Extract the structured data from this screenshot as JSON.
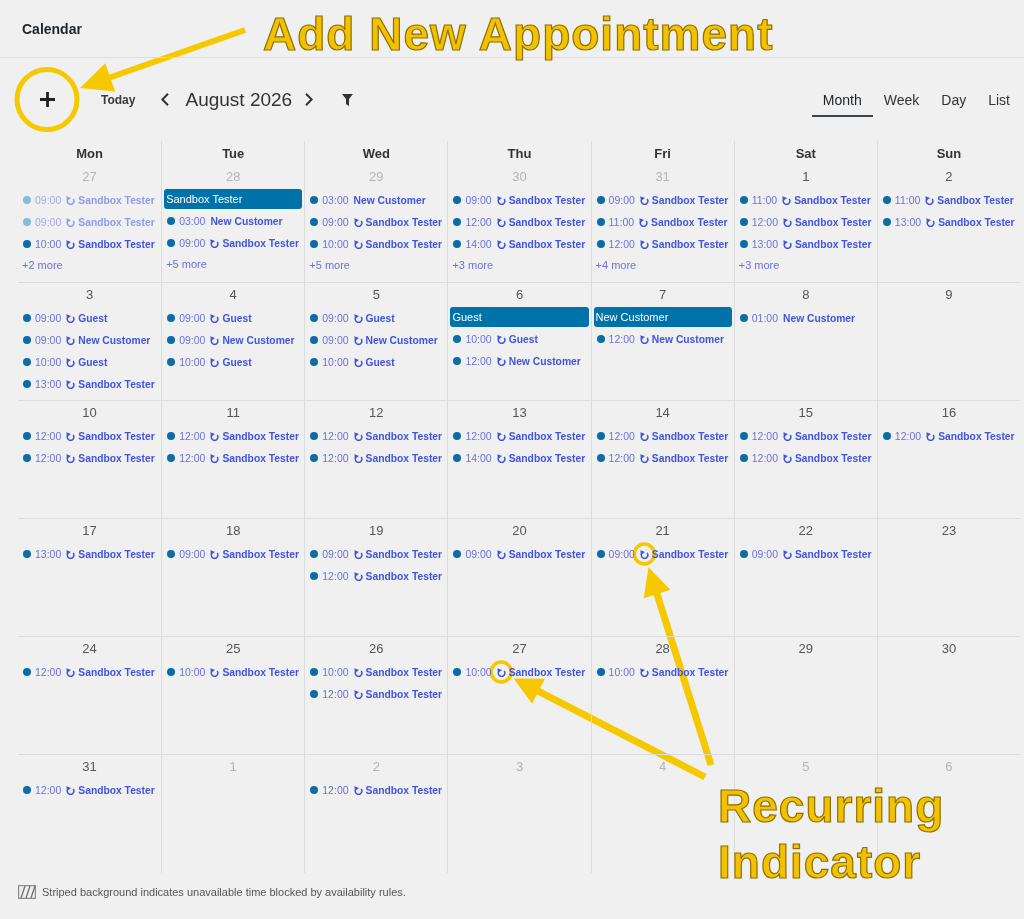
{
  "page": {
    "title": "Calendar"
  },
  "toolbar": {
    "add_button": {
      "circled": true
    },
    "today": "Today",
    "month": "August 2026",
    "views": [
      {
        "label": "Month",
        "selected": true
      },
      {
        "label": "Week",
        "selected": false
      },
      {
        "label": "Day",
        "selected": false
      },
      {
        "label": "List",
        "selected": false
      }
    ]
  },
  "weekdays": [
    "Mon",
    "Tue",
    "Wed",
    "Thu",
    "Fri",
    "Sat",
    "Sun"
  ],
  "weeks": [
    {
      "days": [
        {
          "number": "27",
          "other_month": true,
          "events": [
            {
              "kind": "timed",
              "time": "09:00",
              "recurring": true,
              "title": "Sandbox Tester",
              "dimmed": true,
              "circled": false
            },
            {
              "kind": "timed",
              "time": "09:00",
              "recurring": true,
              "title": "Sandbox Tester",
              "dimmed": true,
              "circled": false
            },
            {
              "kind": "timed",
              "time": "10:00",
              "recurring": true,
              "title": "Sandbox Tester",
              "dimmed": false,
              "circled": false
            }
          ],
          "more": "+2 more"
        },
        {
          "number": "28",
          "other_month": true,
          "events": [
            {
              "kind": "bar",
              "title": "Sandbox Tester"
            },
            {
              "kind": "timed",
              "time": "03:00",
              "recurring": false,
              "title": "New Customer",
              "dimmed": false,
              "circled": false
            },
            {
              "kind": "timed",
              "time": "09:00",
              "recurring": true,
              "title": "Sandbox Tester",
              "dimmed": false,
              "circled": false
            }
          ],
          "more": "+5 more"
        },
        {
          "number": "29",
          "other_month": true,
          "events": [
            {
              "kind": "timed",
              "time": "03:00",
              "recurring": false,
              "title": "New Customer",
              "dimmed": false,
              "circled": false
            },
            {
              "kind": "timed",
              "time": "09:00",
              "recurring": true,
              "title": "Sandbox Tester",
              "dimmed": false,
              "circled": false
            },
            {
              "kind": "timed",
              "time": "10:00",
              "recurring": true,
              "title": "Sandbox Tester",
              "dimmed": false,
              "circled": false
            }
          ],
          "more": "+5 more"
        },
        {
          "number": "30",
          "other_month": true,
          "events": [
            {
              "kind": "timed",
              "time": "09:00",
              "recurring": true,
              "title": "Sandbox Tester",
              "dimmed": false,
              "circled": false
            },
            {
              "kind": "timed",
              "time": "12:00",
              "recurring": true,
              "title": "Sandbox Tester",
              "dimmed": false,
              "circled": false
            },
            {
              "kind": "timed",
              "time": "14:00",
              "recurring": true,
              "title": "Sandbox Tester",
              "dimmed": false,
              "circled": false
            }
          ],
          "more": "+3 more"
        },
        {
          "number": "31",
          "other_month": true,
          "events": [
            {
              "kind": "timed",
              "time": "09:00",
              "recurring": true,
              "title": "Sandbox Tester",
              "dimmed": false,
              "circled": false
            },
            {
              "kind": "timed",
              "time": "11:00",
              "recurring": true,
              "title": "Sandbox Tester",
              "dimmed": false,
              "circled": false
            },
            {
              "kind": "timed",
              "time": "12:00",
              "recurring": true,
              "title": "Sandbox Tester",
              "dimmed": false,
              "circled": false
            }
          ],
          "more": "+4 more"
        },
        {
          "number": "1",
          "other_month": false,
          "events": [
            {
              "kind": "timed",
              "time": "11:00",
              "recurring": true,
              "title": "Sandbox Tester",
              "dimmed": false,
              "circled": false
            },
            {
              "kind": "timed",
              "time": "12:00",
              "recurring": true,
              "title": "Sandbox Tester",
              "dimmed": false,
              "circled": false
            },
            {
              "kind": "timed",
              "time": "13:00",
              "recurring": true,
              "title": "Sandbox Tester",
              "dimmed": false,
              "circled": false
            }
          ],
          "more": "+3 more"
        },
        {
          "number": "2",
          "other_month": false,
          "events": [
            {
              "kind": "timed",
              "time": "11:00",
              "recurring": true,
              "title": "Sandbox Tester",
              "dimmed": false,
              "circled": false
            },
            {
              "kind": "timed",
              "time": "13:00",
              "recurring": true,
              "title": "Sandbox Tester",
              "dimmed": false,
              "circled": false
            }
          ]
        }
      ]
    },
    {
      "days": [
        {
          "number": "3",
          "other_month": false,
          "events": [
            {
              "kind": "timed",
              "time": "09:00",
              "recurring": true,
              "title": "Guest",
              "dimmed": false,
              "circled": false
            },
            {
              "kind": "timed",
              "time": "09:00",
              "recurring": true,
              "title": "New Customer",
              "dimmed": false,
              "circled": false
            },
            {
              "kind": "timed",
              "time": "10:00",
              "recurring": true,
              "title": "Guest",
              "dimmed": false,
              "circled": false
            },
            {
              "kind": "timed",
              "time": "13:00",
              "recurring": true,
              "title": "Sandbox Tester",
              "dimmed": false,
              "circled": false
            }
          ]
        },
        {
          "number": "4",
          "other_month": false,
          "events": [
            {
              "kind": "timed",
              "time": "09:00",
              "recurring": true,
              "title": "Guest",
              "dimmed": false,
              "circled": false
            },
            {
              "kind": "timed",
              "time": "09:00",
              "recurring": true,
              "title": "New Customer",
              "dimmed": false,
              "circled": false
            },
            {
              "kind": "timed",
              "time": "10:00",
              "recurring": true,
              "title": "Guest",
              "dimmed": false,
              "circled": false
            }
          ]
        },
        {
          "number": "5",
          "other_month": false,
          "events": [
            {
              "kind": "timed",
              "time": "09:00",
              "recurring": true,
              "title": "Guest",
              "dimmed": false,
              "circled": false
            },
            {
              "kind": "timed",
              "time": "09:00",
              "recurring": true,
              "title": "New Customer",
              "dimmed": false,
              "circled": false
            },
            {
              "kind": "timed",
              "time": "10:00",
              "recurring": true,
              "title": "Guest",
              "dimmed": false,
              "circled": false
            }
          ]
        },
        {
          "number": "6",
          "other_month": false,
          "events": [
            {
              "kind": "bar",
              "title": "Guest"
            },
            {
              "kind": "timed",
              "time": "10:00",
              "recurring": true,
              "title": "Guest",
              "dimmed": false,
              "circled": false
            },
            {
              "kind": "timed",
              "time": "12:00",
              "recurring": true,
              "title": "New Customer",
              "dimmed": false,
              "circled": false
            }
          ]
        },
        {
          "number": "7",
          "other_month": false,
          "events": [
            {
              "kind": "bar",
              "title": "New Customer"
            },
            {
              "kind": "timed",
              "time": "12:00",
              "recurring": true,
              "title": "New Customer",
              "dimmed": false,
              "circled": false
            }
          ]
        },
        {
          "number": "8",
          "other_month": false,
          "events": [
            {
              "kind": "timed",
              "time": "01:00",
              "recurring": false,
              "title": "New Customer",
              "dimmed": false,
              "circled": false
            }
          ]
        },
        {
          "number": "9",
          "other_month": false
        }
      ]
    },
    {
      "days": [
        {
          "number": "10",
          "other_month": false,
          "events": [
            {
              "kind": "timed",
              "time": "12:00",
              "recurring": true,
              "title": "Sandbox Tester",
              "dimmed": false,
              "circled": false
            },
            {
              "kind": "timed",
              "time": "12:00",
              "recurring": true,
              "title": "Sandbox Tester",
              "dimmed": false,
              "circled": false
            }
          ]
        },
        {
          "number": "11",
          "other_month": false,
          "events": [
            {
              "kind": "timed",
              "time": "12:00",
              "recurring": true,
              "title": "Sandbox Tester",
              "dimmed": false,
              "circled": false
            },
            {
              "kind": "timed",
              "time": "12:00",
              "recurring": true,
              "title": "Sandbox Tester",
              "dimmed": false,
              "circled": false
            }
          ]
        },
        {
          "number": "12",
          "other_month": false,
          "events": [
            {
              "kind": "timed",
              "time": "12:00",
              "recurring": true,
              "title": "Sandbox Tester",
              "dimmed": false,
              "circled": false
            },
            {
              "kind": "timed",
              "time": "12:00",
              "recurring": true,
              "title": "Sandbox Tester",
              "dimmed": false,
              "circled": false
            }
          ]
        },
        {
          "number": "13",
          "other_month": false,
          "events": [
            {
              "kind": "timed",
              "time": "12:00",
              "recurring": true,
              "title": "Sandbox Tester",
              "dimmed": false,
              "circled": false
            },
            {
              "kind": "timed",
              "time": "14:00",
              "recurring": true,
              "title": "Sandbox Tester",
              "dimmed": false,
              "circled": false
            }
          ]
        },
        {
          "number": "14",
          "other_month": false,
          "events": [
            {
              "kind": "timed",
              "time": "12:00",
              "recurring": true,
              "title": "Sandbox Tester",
              "dimmed": false,
              "circled": false
            },
            {
              "kind": "timed",
              "time": "12:00",
              "recurring": true,
              "title": "Sandbox Tester",
              "dimmed": false,
              "circled": false
            }
          ]
        },
        {
          "number": "15",
          "other_month": false,
          "events": [
            {
              "kind": "timed",
              "time": "12:00",
              "recurring": true,
              "title": "Sandbox Tester",
              "dimmed": false,
              "circled": false
            },
            {
              "kind": "timed",
              "time": "12:00",
              "recurring": true,
              "title": "Sandbox Tester",
              "dimmed": false,
              "circled": false
            }
          ]
        },
        {
          "number": "16",
          "other_month": false,
          "events": [
            {
              "kind": "timed",
              "time": "12:00",
              "recurring": true,
              "title": "Sandbox Tester",
              "dimmed": false,
              "circled": false
            }
          ]
        }
      ]
    },
    {
      "days": [
        {
          "number": "17",
          "other_month": false,
          "events": [
            {
              "kind": "timed",
              "time": "13:00",
              "recurring": true,
              "title": "Sandbox Tester",
              "dimmed": false,
              "circled": false
            }
          ]
        },
        {
          "number": "18",
          "other_month": false,
          "events": [
            {
              "kind": "timed",
              "time": "09:00",
              "recurring": true,
              "title": "Sandbox Tester",
              "dimmed": false,
              "circled": false
            }
          ]
        },
        {
          "number": "19",
          "other_month": false,
          "events": [
            {
              "kind": "timed",
              "time": "09:00",
              "recurring": true,
              "title": "Sandbox Tester",
              "dimmed": false,
              "circled": false
            },
            {
              "kind": "timed",
              "time": "12:00",
              "recurring": true,
              "title": "Sandbox Tester",
              "dimmed": false,
              "circled": false
            }
          ]
        },
        {
          "number": "20",
          "other_month": false,
          "events": [
            {
              "kind": "timed",
              "time": "09:00",
              "recurring": true,
              "title": "Sandbox Tester",
              "dimmed": false,
              "circled": false
            }
          ]
        },
        {
          "number": "21",
          "other_month": false,
          "events": [
            {
              "kind": "timed",
              "time": "09:00",
              "recurring": true,
              "title": "Sandbox Tester",
              "dimmed": false,
              "circled": true
            }
          ]
        },
        {
          "number": "22",
          "other_month": false,
          "events": [
            {
              "kind": "timed",
              "time": "09:00",
              "recurring": true,
              "title": "Sandbox Tester",
              "dimmed": false,
              "circled": false
            }
          ]
        },
        {
          "number": "23",
          "other_month": false
        }
      ]
    },
    {
      "days": [
        {
          "number": "24",
          "other_month": false,
          "events": [
            {
              "kind": "timed",
              "time": "12:00",
              "recurring": true,
              "title": "Sandbox Tester",
              "dimmed": false,
              "circled": false
            }
          ]
        },
        {
          "number": "25",
          "other_month": false,
          "events": [
            {
              "kind": "timed",
              "time": "10:00",
              "recurring": true,
              "title": "Sandbox Tester",
              "dimmed": false,
              "circled": false
            }
          ]
        },
        {
          "number": "26",
          "other_month": false,
          "events": [
            {
              "kind": "timed",
              "time": "10:00",
              "recurring": true,
              "title": "Sandbox Tester",
              "dimmed": false,
              "circled": false
            },
            {
              "kind": "timed",
              "time": "12:00",
              "recurring": true,
              "title": "Sandbox Tester",
              "dimmed": false,
              "circled": false
            }
          ]
        },
        {
          "number": "27",
          "other_month": false,
          "events": [
            {
              "kind": "timed",
              "time": "10:00",
              "recurring": true,
              "title": "Sandbox Tester",
              "dimmed": false,
              "circled": true
            }
          ]
        },
        {
          "number": "28",
          "other_month": false,
          "events": [
            {
              "kind": "timed",
              "time": "10:00",
              "recurring": true,
              "title": "Sandbox Tester",
              "dimmed": false,
              "circled": false
            }
          ]
        },
        {
          "number": "29",
          "other_month": false
        },
        {
          "number": "30",
          "other_month": false
        }
      ]
    },
    {
      "days": [
        {
          "number": "31",
          "other_month": false,
          "events": [
            {
              "kind": "timed",
              "time": "12:00",
              "recurring": true,
              "title": "Sandbox Tester",
              "dimmed": false,
              "circled": false
            }
          ]
        },
        {
          "number": "1",
          "other_month": true
        },
        {
          "number": "2",
          "other_month": true,
          "events": [
            {
              "kind": "timed",
              "time": "12:00",
              "recurring": true,
              "title": "Sandbox Tester",
              "dimmed": false,
              "circled": false
            }
          ]
        },
        {
          "number": "3",
          "other_month": true
        },
        {
          "number": "4",
          "other_month": true
        },
        {
          "number": "5",
          "other_month": true
        },
        {
          "number": "6",
          "other_month": true
        }
      ]
    }
  ],
  "legend": {
    "text": "Striped background indicates unavailable time blocked by availability rules."
  },
  "callouts": [
    {
      "text": "Add New Appointment"
    },
    {
      "text": "Recurring Indicator"
    }
  ]
}
